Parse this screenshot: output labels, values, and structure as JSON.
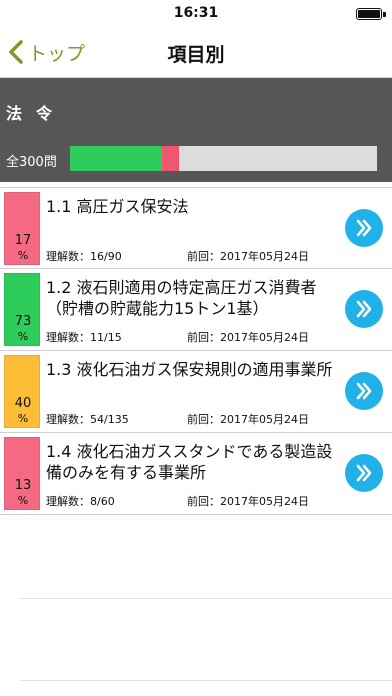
{
  "status_bar": {
    "time": "16:31"
  },
  "nav": {
    "back_label": "トップ",
    "title": "項目別"
  },
  "section": {
    "title": "法令",
    "total_label": "全300問",
    "progress": [
      {
        "name": "understood",
        "fraction": 0.3,
        "color": "#2ecc5a"
      },
      {
        "name": "partial",
        "fraction": 0.055,
        "color": "#f0566e"
      }
    ]
  },
  "items": [
    {
      "title": "1.1 高圧ガス保安法",
      "percent": "17",
      "percent_sign": "%",
      "color": "#f46a82",
      "understood": "理解数：16/90",
      "last": "前回：2017年05月24日"
    },
    {
      "title": "1.2 液石則適用の特定高圧ガス消費者（貯槽の貯蔵能力15トン1基）",
      "percent": "73",
      "percent_sign": "%",
      "color": "#2ecc5a",
      "understood": "理解数：11/15",
      "last": "前回：2017年05月24日"
    },
    {
      "title": "1.3 液化石油ガス保安規則の適用事業所",
      "percent": "40",
      "percent_sign": "%",
      "color": "#fbbd36",
      "understood": "理解数：54/135",
      "last": "前回：2017年05月24日"
    },
    {
      "title": "1.4 液化石油ガススタンドである製造設備のみを有する事業所",
      "percent": "13",
      "percent_sign": "%",
      "color": "#f46a82",
      "understood": "理解数：8/60",
      "last": "前回：2017年05月24日"
    }
  ]
}
